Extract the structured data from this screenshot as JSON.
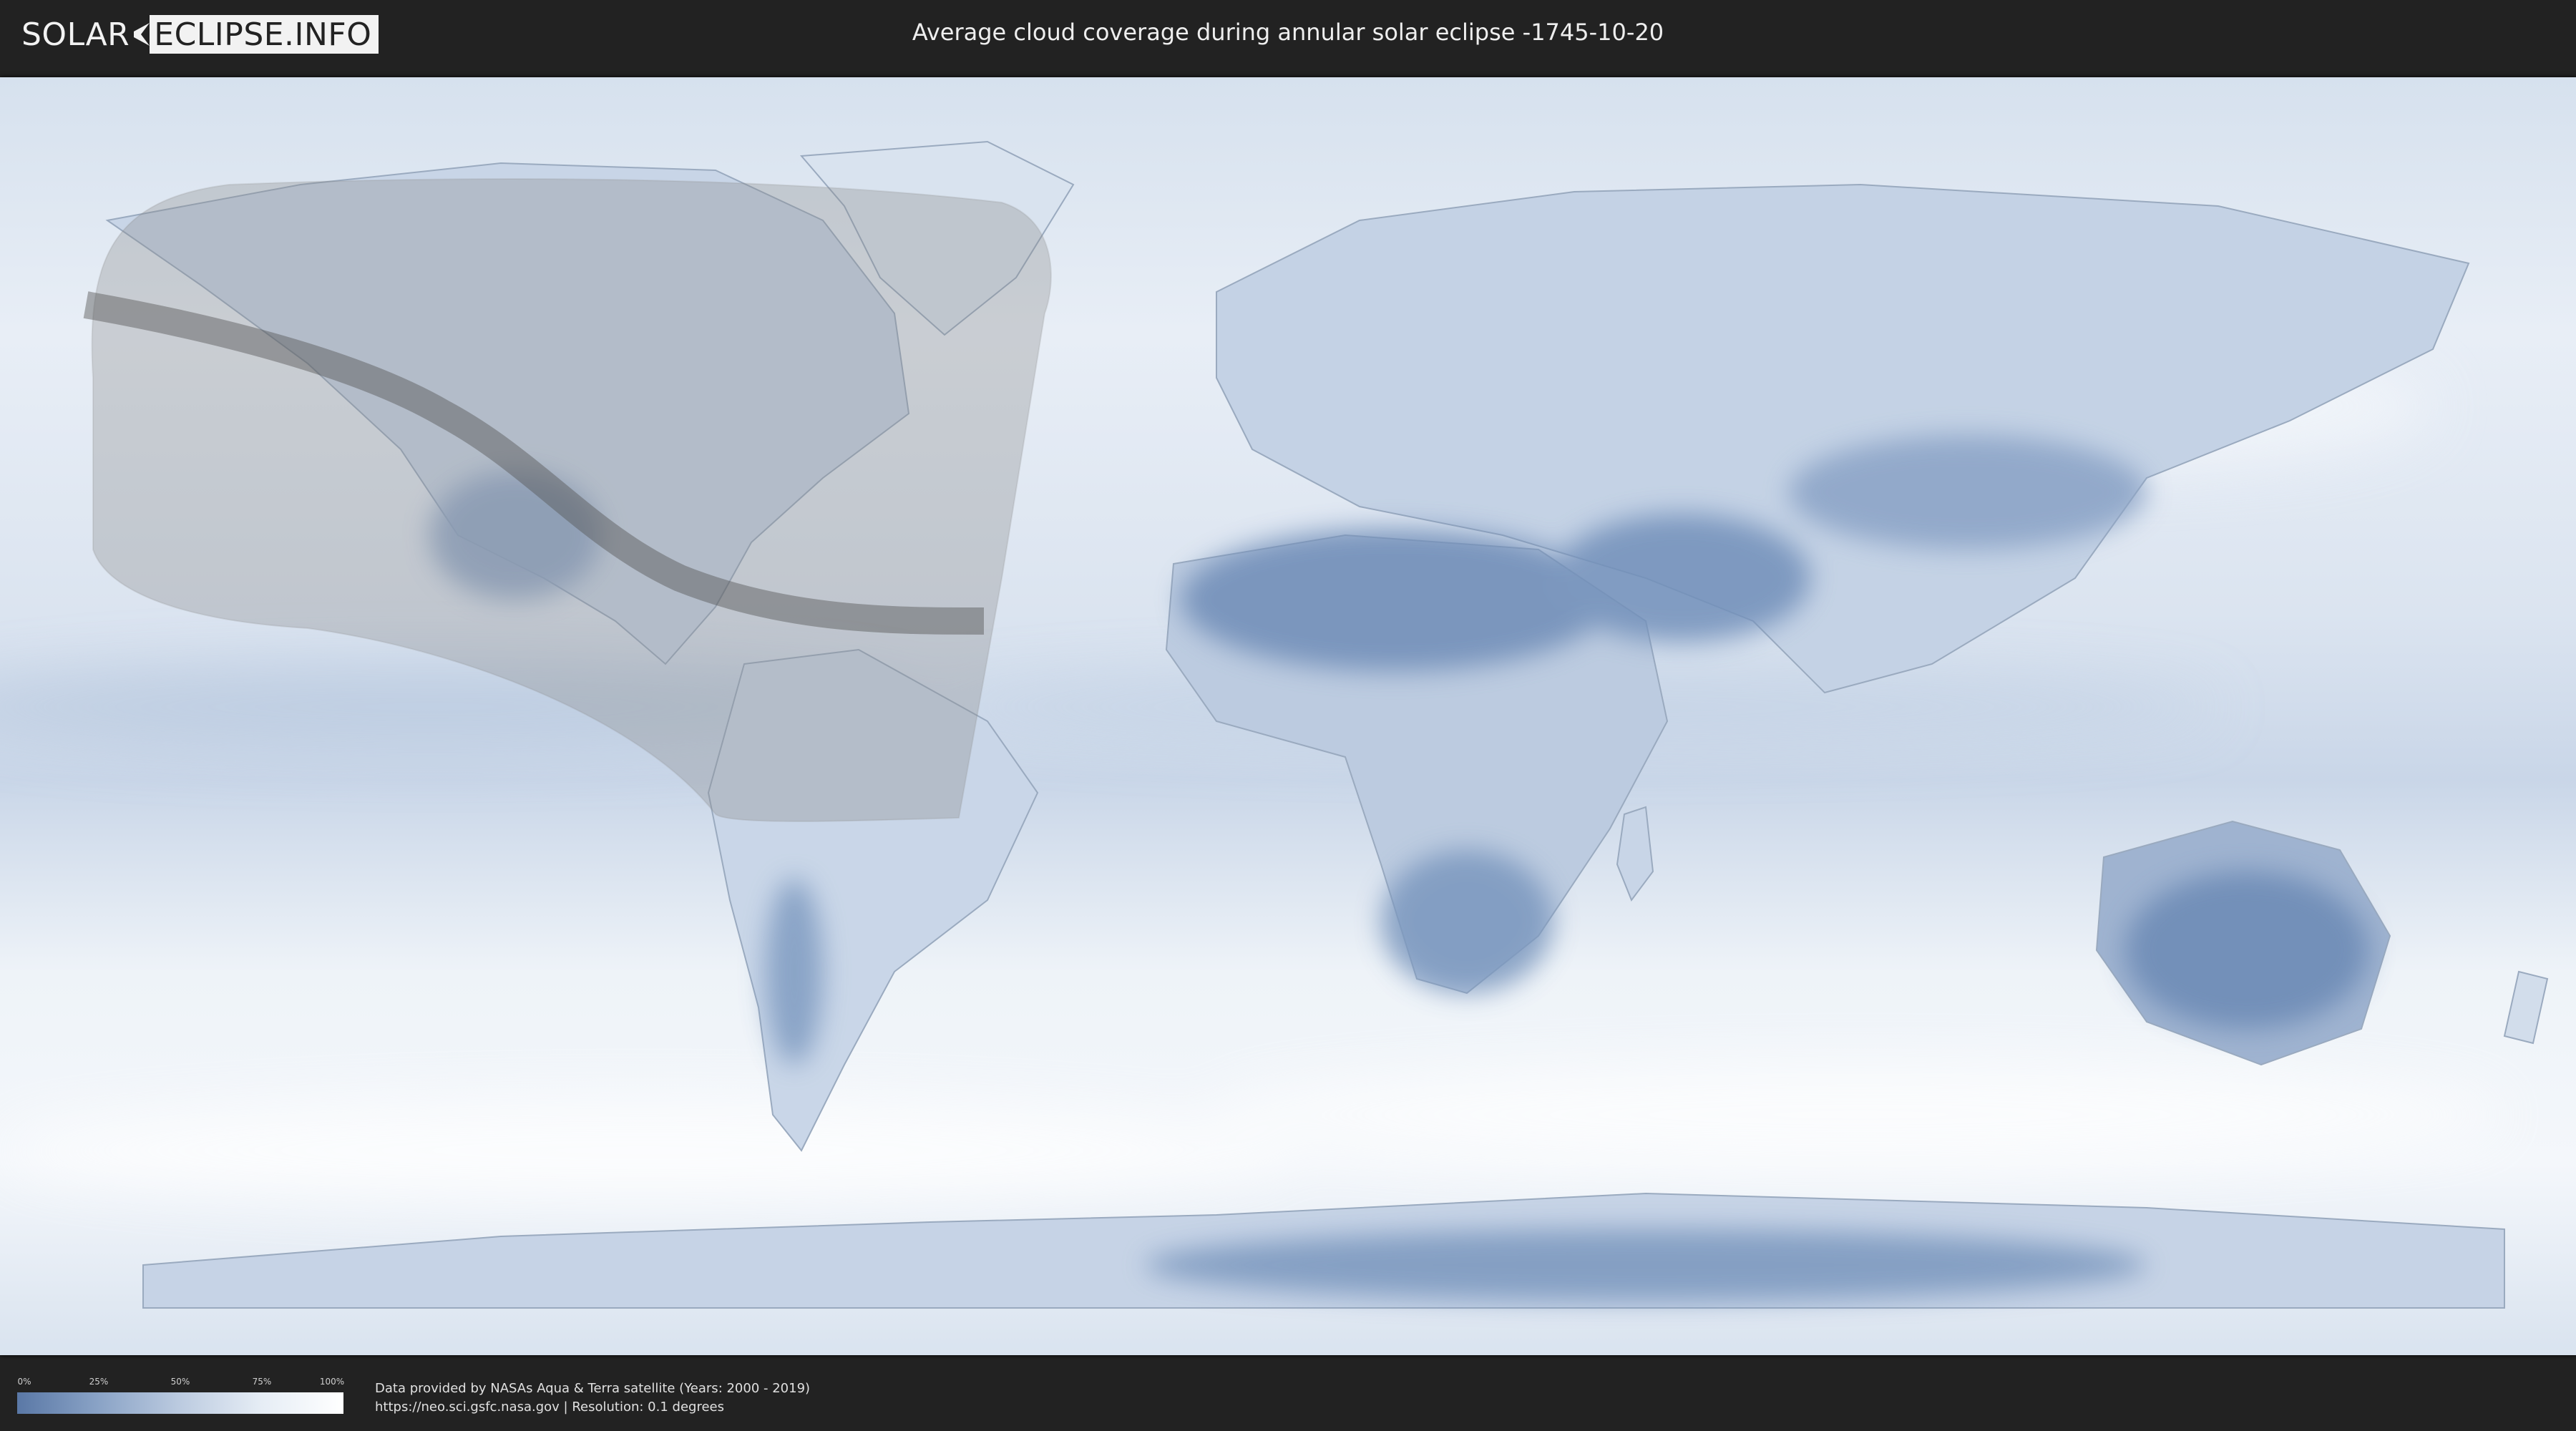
{
  "header": {
    "logo_part1": "SOLAR",
    "logo_part2": "ECLIPSE.INFO",
    "title": "Average cloud coverage during annular solar eclipse -1745-10-20"
  },
  "legend": {
    "ticks": [
      "0%",
      "25%",
      "50%",
      "75%",
      "100%"
    ],
    "colors": [
      "#5a78a6",
      "#8aa3c6",
      "#bccbe0",
      "#e6edf5",
      "#ffffff"
    ]
  },
  "footer": {
    "credit_line": "Data provided by NASAs Aqua & Terra satellite (Years: 2000 - 2019)",
    "source_line": "https://neo.sci.gsfc.nasa.gov | Resolution: 0.1 degrees"
  },
  "map": {
    "ocean_color": "#e4ecf5",
    "land_fill": "#c7d4e6",
    "dry_fill": "#6f8db8",
    "eclipse_zone_color": "#8a8a8a",
    "eclipse_path_color": "#555555"
  }
}
